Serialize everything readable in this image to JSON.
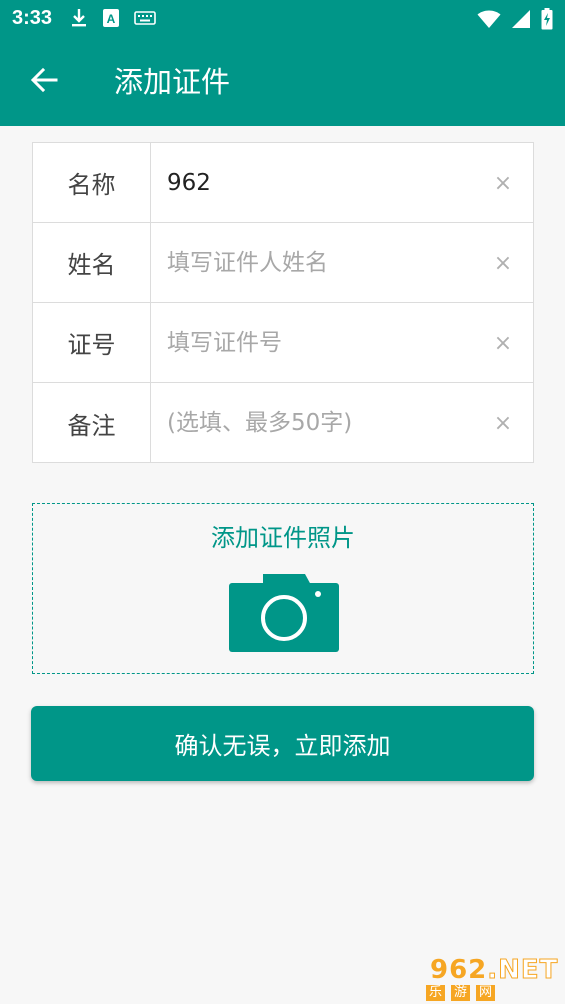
{
  "status_bar": {
    "time": "3:33",
    "left_icons": [
      "download-icon",
      "font-a-icon",
      "keyboard-icon"
    ],
    "right_icons": [
      "wifi-icon",
      "signal-icon",
      "battery-charging-icon"
    ]
  },
  "app_bar": {
    "back_icon": "arrow-left-icon",
    "title": "添加证件"
  },
  "form": {
    "rows": [
      {
        "label": "名称",
        "value": "962",
        "placeholder": ""
      },
      {
        "label": "姓名",
        "value": "",
        "placeholder": "填写证件人姓名"
      },
      {
        "label": "证号",
        "value": "",
        "placeholder": "填写证件号"
      },
      {
        "label": "备注",
        "value": "",
        "placeholder": "(选填、最多50字)"
      }
    ],
    "clear_symbol": "×"
  },
  "photo": {
    "title": "添加证件照片",
    "icon": "camera-icon"
  },
  "confirm_button": {
    "label": "确认无误，立即添加"
  },
  "watermark": {
    "logo_text": "962.NET",
    "sub_text": "乐游网"
  },
  "colors": {
    "primary": "#009688",
    "background": "#f7f7f7",
    "watermark": "#f6a623"
  }
}
